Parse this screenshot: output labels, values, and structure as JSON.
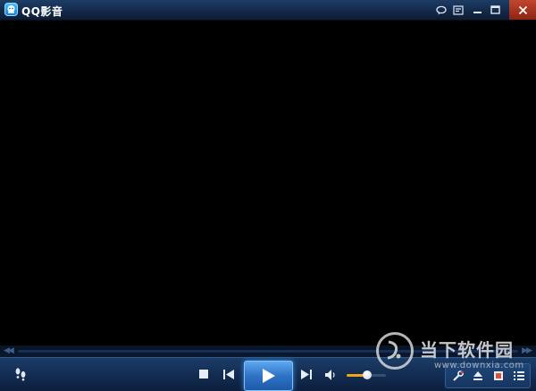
{
  "window": {
    "title": "QQ影音"
  },
  "titlebar_buttons": [
    "chat-bubble-icon",
    "playlist-edit-icon",
    "minimize-icon",
    "maximize-icon",
    "close-icon"
  ],
  "seekbar": {
    "progress": 0
  },
  "controls": {
    "buttons": [
      "footprint-icon",
      "stop-icon",
      "previous-icon",
      "play-icon",
      "next-icon",
      "volume-icon",
      "tools-icon",
      "eject-icon",
      "screenshot-icon",
      "playlist-icon"
    ],
    "volume_level": 0.52
  },
  "watermark": {
    "text": "当下软件园",
    "url": "www.downxia.com"
  },
  "colors": {
    "accent": "#2f73c6",
    "close": "#c1462f",
    "volume": "#f2a31b"
  }
}
